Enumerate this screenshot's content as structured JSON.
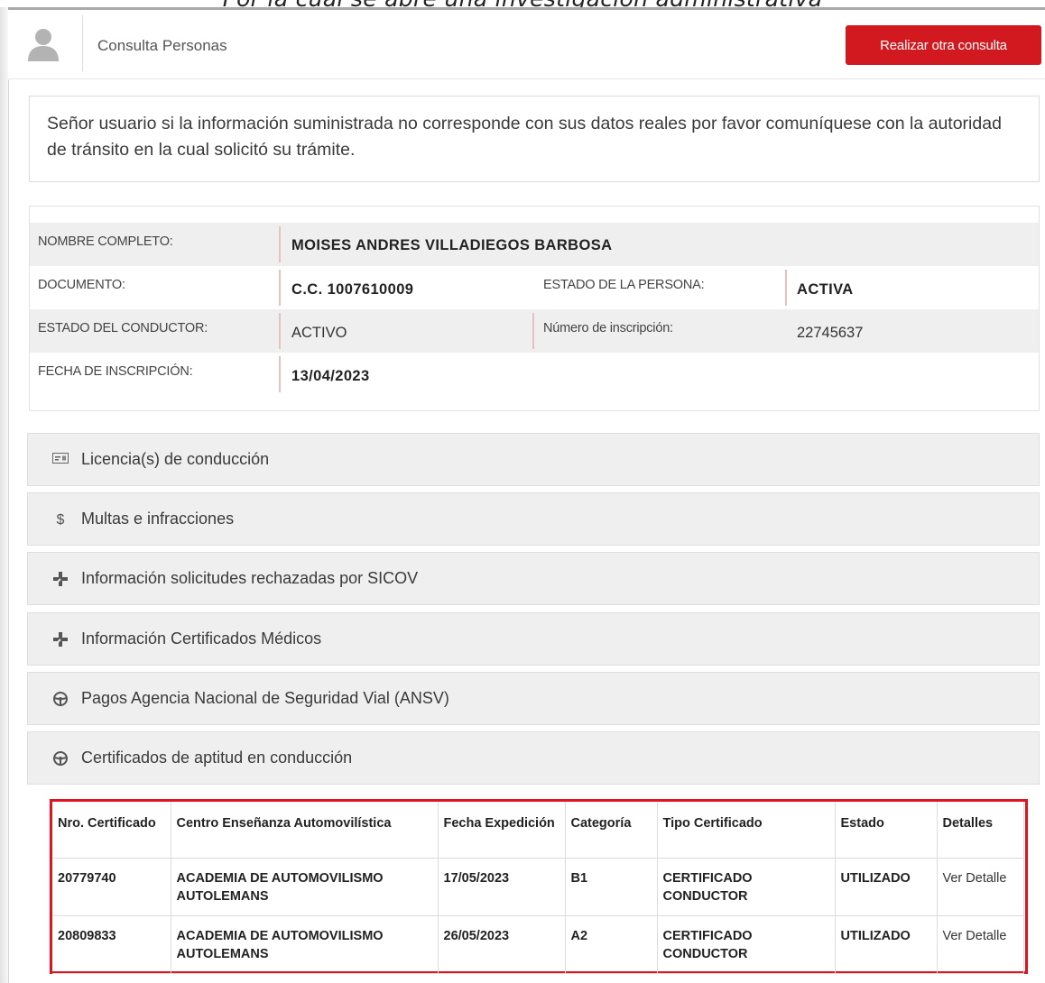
{
  "caption": "Por la cual se abre una investigación administrativa",
  "header": {
    "title": "Consulta Personas",
    "new_query_button": "Realizar otra consulta"
  },
  "notice": "Señor usuario si la información suministrada no corresponde con sus datos reales por favor comuníquese con la autoridad de tránsito en la cual solicitó su trámite.",
  "person": {
    "nombre_label": "NOMBRE COMPLETO:",
    "nombre_value": "MOISES ANDRES VILLADIEGOS BARBOSA",
    "documento_label": "DOCUMENTO:",
    "documento_value": "C.C. 1007610009",
    "estado_persona_label": "ESTADO DE LA PERSONA:",
    "estado_persona_value": "ACTIVA",
    "estado_conductor_label": "ESTADO DEL CONDUCTOR:",
    "estado_conductor_value": "ACTIVO",
    "inscripcion_num_label": "Número de inscripción:",
    "inscripcion_num_value": "22745637",
    "fecha_inscripcion_label": "FECHA DE INSCRIPCIÓN:",
    "fecha_inscripcion_value": "13/04/2023"
  },
  "panels": [
    {
      "label": "Licencia(s) de conducción",
      "icon": "license-card-icon"
    },
    {
      "label": "Multas e infracciones",
      "icon": "dollar-icon"
    },
    {
      "label": "Información solicitudes rechazadas por SICOV",
      "icon": "medical-plus-icon"
    },
    {
      "label": "Información Certificados Médicos",
      "icon": "medical-plus-icon"
    },
    {
      "label": "Pagos Agencia Nacional de Seguridad Vial (ANSV)",
      "icon": "steering-wheel-icon"
    },
    {
      "label": "Certificados de aptitud en conducción",
      "icon": "steering-wheel-icon"
    }
  ],
  "certificates": {
    "headers": [
      "Nro. Certificado",
      "Centro Enseñanza Automovilística",
      "Fecha Expedición",
      "Categoría",
      "Tipo Certificado",
      "Estado",
      "Detalles"
    ],
    "rows": [
      [
        "20779740",
        "ACADEMIA DE AUTOMOVILISMO AUTOLEMANS",
        "17/05/2023",
        "B1",
        "CERTIFICADO CONDUCTOR",
        "UTILIZADO",
        "Ver Detalle"
      ],
      [
        "20809833",
        "ACADEMIA DE AUTOMOVILISMO AUTOLEMANS",
        "26/05/2023",
        "A2",
        "CERTIFICADO CONDUCTOR",
        "UTILIZADO",
        "Ver Detalle"
      ]
    ]
  },
  "colors": {
    "accent_red": "#d31920",
    "highlight_border": "#e0141e"
  }
}
